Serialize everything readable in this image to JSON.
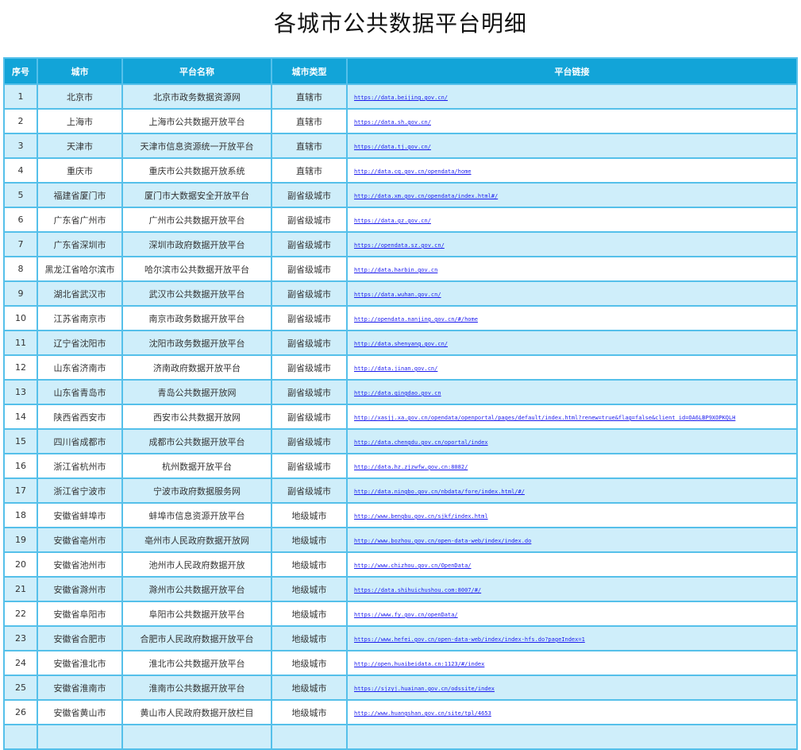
{
  "page": {
    "title": "各城市公共数据平台明细"
  },
  "table": {
    "headers": [
      "序号",
      "城市",
      "平台名称",
      "城市类型",
      "平台链接"
    ],
    "rows": [
      [
        "1",
        "北京市",
        "北京市政务数据资源网",
        "直辖市",
        "https://data.beijing.gov.cn/"
      ],
      [
        "2",
        "上海市",
        "上海市公共数据开放平台",
        "直辖市",
        "https://data.sh.gov.cn/"
      ],
      [
        "3",
        "天津市",
        "天津市信息资源统一开放平台",
        "直辖市",
        "https://data.tj.gov.cn/"
      ],
      [
        "4",
        "重庆市",
        "重庆市公共数据开放系统",
        "直辖市",
        "http://data.cq.gov.cn/opendata/home"
      ],
      [
        "5",
        "福建省厦门市",
        "厦门市大数据安全开放平台",
        "副省级城市",
        "http://data.xm.gov.cn/opendata/index.html#/"
      ],
      [
        "6",
        "广东省广州市",
        "广州市公共数据开放平台",
        "副省级城市",
        "https://data.gz.gov.cn/"
      ],
      [
        "7",
        "广东省深圳市",
        "深圳市政府数据开放平台",
        "副省级城市",
        "https://opendata.sz.gov.cn/"
      ],
      [
        "8",
        "黑龙江省哈尔滨市",
        "哈尔滨市公共数据开放平台",
        "副省级城市",
        "http://data.harbin.gov.cn"
      ],
      [
        "9",
        "湖北省武汉市",
        "武汉市公共数据开放平台",
        "副省级城市",
        "https://data.wuhan.gov.cn/"
      ],
      [
        "10",
        "江苏省南京市",
        "南京市政务数据开放平台",
        "副省级城市",
        "http://opendata.nanjing.gov.cn/#/home"
      ],
      [
        "11",
        "辽宁省沈阳市",
        "沈阳市政务数据开放平台",
        "副省级城市",
        "http://data.shenyang.gov.cn/"
      ],
      [
        "12",
        "山东省济南市",
        "济南政府数据开放平台",
        "副省级城市",
        "http://data.jinan.gov.cn/"
      ],
      [
        "13",
        "山东省青岛市",
        "青岛公共数据开放网",
        "副省级城市",
        "http://data.qingdao.gov.cn"
      ],
      [
        "14",
        "陕西省西安市",
        "西安市公共数据开放网",
        "副省级城市",
        "http://xasjj.xa.gov.cn/opendata/openportal/pages/default/index.html?renew=true&flag=false&client_id=OA6LBP9XOPKQLH"
      ],
      [
        "15",
        "四川省成都市",
        "成都市公共数据开放平台",
        "副省级城市",
        "http://data.chengdu.gov.cn/oportal/index"
      ],
      [
        "16",
        "浙江省杭州市",
        "杭州数据开放平台",
        "副省级城市",
        "http://data.hz.zjzwfw.gov.cn:8082/"
      ],
      [
        "17",
        "浙江省宁波市",
        "宁波市政府数据服务网",
        "副省级城市",
        "http://data.ningbo.gov.cn/nbdata/fore/index.html/#/"
      ],
      [
        "18",
        "安徽省蚌埠市",
        "蚌埠市信息资源开放平台",
        "地级城市",
        "http://www.bengbu.gov.cn/sjkf/index.html"
      ],
      [
        "19",
        "安徽省亳州市",
        "亳州市人民政府数据开放网",
        "地级城市",
        "http://www.bozhou.gov.cn/open-data-web/index/index.do"
      ],
      [
        "20",
        "安徽省池州市",
        "池州市人民政府数据开放",
        "地级城市",
        "http://www.chizhou.gov.cn/OpenData/"
      ],
      [
        "21",
        "安徽省滁州市",
        "滁州市公共数据开放平台",
        "地级城市",
        "https://data.shihuichushou.com:8007/#/"
      ],
      [
        "22",
        "安徽省阜阳市",
        "阜阳市公共数据开放平台",
        "地级城市",
        "https://www.fy.gov.cn/openData/"
      ],
      [
        "23",
        "安徽省合肥市",
        "合肥市人民政府数据开放平台",
        "地级城市",
        "https://www.hefei.gov.cn/open-data-web/index/index-hfs.do?pageIndex=1"
      ],
      [
        "24",
        "安徽省淮北市",
        "淮北市公共数据开放平台",
        "地级城市",
        "http://open.huaibeidata.cn:1123/#/index"
      ],
      [
        "25",
        "安徽省淮南市",
        "淮南市公共数据开放平台",
        "地级城市",
        "https://sjzyj.huainan.gov.cn/odssite/index"
      ],
      [
        "26",
        "安徽省黄山市",
        "黄山市人民政府数据开放栏目",
        "地级城市",
        "http://www.huangshan.gov.cn/site/tpl/4653"
      ],
      [
        "",
        "",
        "",
        "",
        ""
      ]
    ]
  }
}
